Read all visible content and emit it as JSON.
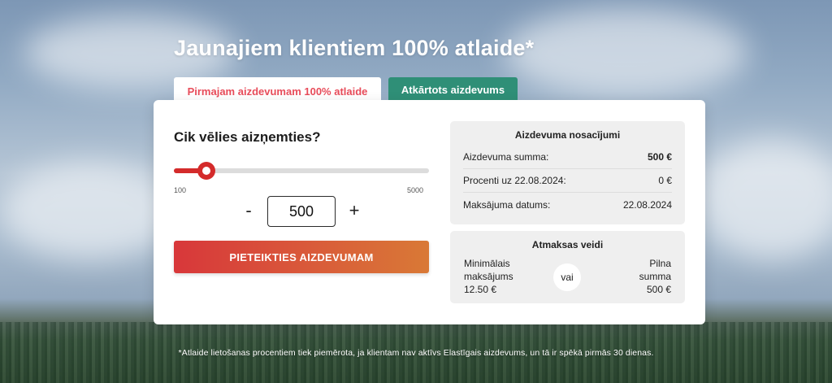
{
  "headline": "Jaunajiem klientiem 100% atlaide*",
  "tabs": {
    "first": "Pirmajam aizdevumam 100% atlaide",
    "repeat": "Atkārtots aizdevums"
  },
  "calculator": {
    "question": "Cik vēlies aizņemties?",
    "slider_min_label": "100",
    "slider_max_label": "5000",
    "slider_min": 100,
    "slider_max": 5000,
    "slider_value": 500,
    "minus_label": "-",
    "plus_label": "+",
    "amount_value": "500",
    "apply_label": "PIETEIKTIES AIZDEVUMAM"
  },
  "terms": {
    "title": "Aizdevuma nosacījumi",
    "rows": [
      {
        "label": "Aizdevuma summa:",
        "value": "500 €"
      },
      {
        "label": "Procenti uz 22.08.2024:",
        "value": "0 €"
      },
      {
        "label": "Maksājuma datums:",
        "value": "22.08.2024"
      }
    ]
  },
  "repayment": {
    "title": "Atmaksas veidi",
    "left_line1": "Minimālais",
    "left_line2": "maksājums",
    "left_amount": "12.50 €",
    "separator": "vai",
    "right_line1": "Pilna",
    "right_line2": "summa",
    "right_amount": "500 €"
  },
  "footnote": "*Atlaide lietošanas procentiem tiek piemērota, ja klientam nav aktīvs Elastīgais aizdevums, un tā ir spēkā pirmās 30 dienas.",
  "colors": {
    "accent_red": "#d42b2b",
    "tab_active_text": "#e84c5a",
    "tab_repeat_bg": "#2f8f77"
  }
}
